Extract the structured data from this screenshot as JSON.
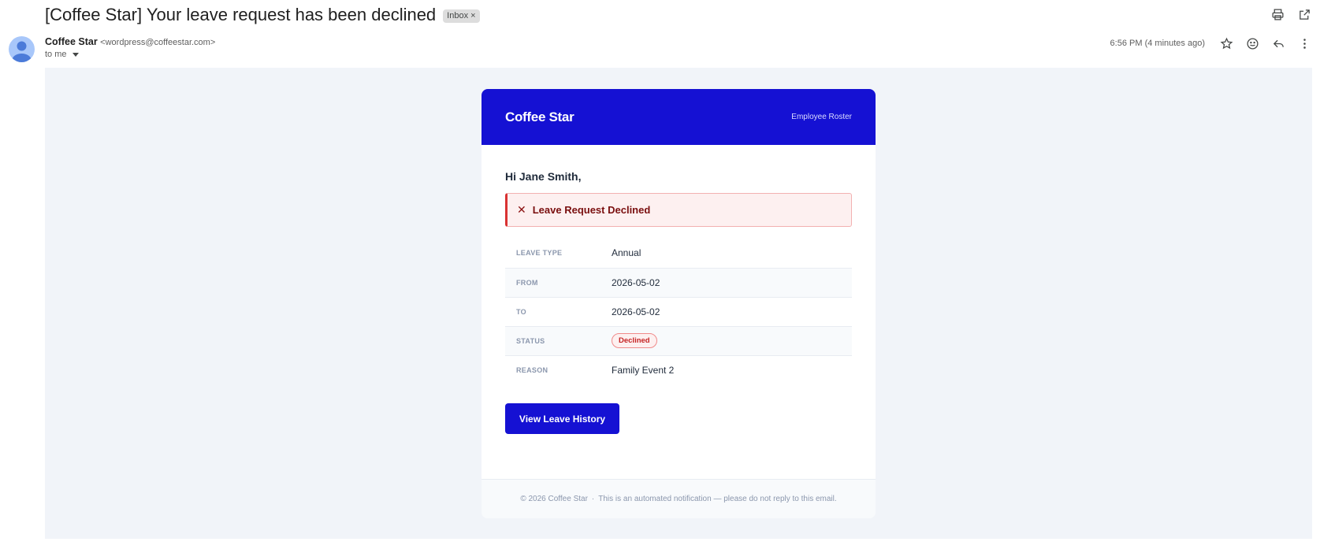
{
  "email": {
    "subject": "[Coffee Star] Your leave request has been declined",
    "label_chip": "Inbox",
    "label_chip_close": "×",
    "sender_name": "Coffee Star",
    "sender_email": "<wordpress@coffeestar.com>",
    "recipient_line": "to me",
    "timestamp": "6:56 PM (4 minutes ago)"
  },
  "icons": {
    "print": "printer-icon",
    "open_new_window": "open-in-new-icon",
    "star": "star-icon",
    "emoji": "emoji-icon",
    "reply": "reply-icon",
    "more": "more-vertical-icon",
    "avatar": "person-icon",
    "declined": "close-icon"
  },
  "card": {
    "brand": "Coffee Star",
    "header_right": "Employee Roster",
    "greeting": "Hi Jane Smith,",
    "alert_icon": "✕",
    "alert_text": "Leave Request Declined",
    "rows": [
      {
        "label": "LEAVE TYPE",
        "value": "Annual"
      },
      {
        "label": "FROM",
        "value": "2026-05-02"
      },
      {
        "label": "TO",
        "value": "2026-05-02"
      },
      {
        "label": "STATUS",
        "value": "Declined"
      },
      {
        "label": "REASON",
        "value": "Family Event 2"
      }
    ],
    "button_label": "View Leave History",
    "footer_copyright": "© 2026 Coffee Star",
    "footer_separator": "·",
    "footer_note": "This is an automated notification — please do not reply to this email."
  },
  "colors": {
    "brand_blue": "#1511d3",
    "declined_red": "#c52424",
    "body_bg": "#f1f4f9"
  }
}
